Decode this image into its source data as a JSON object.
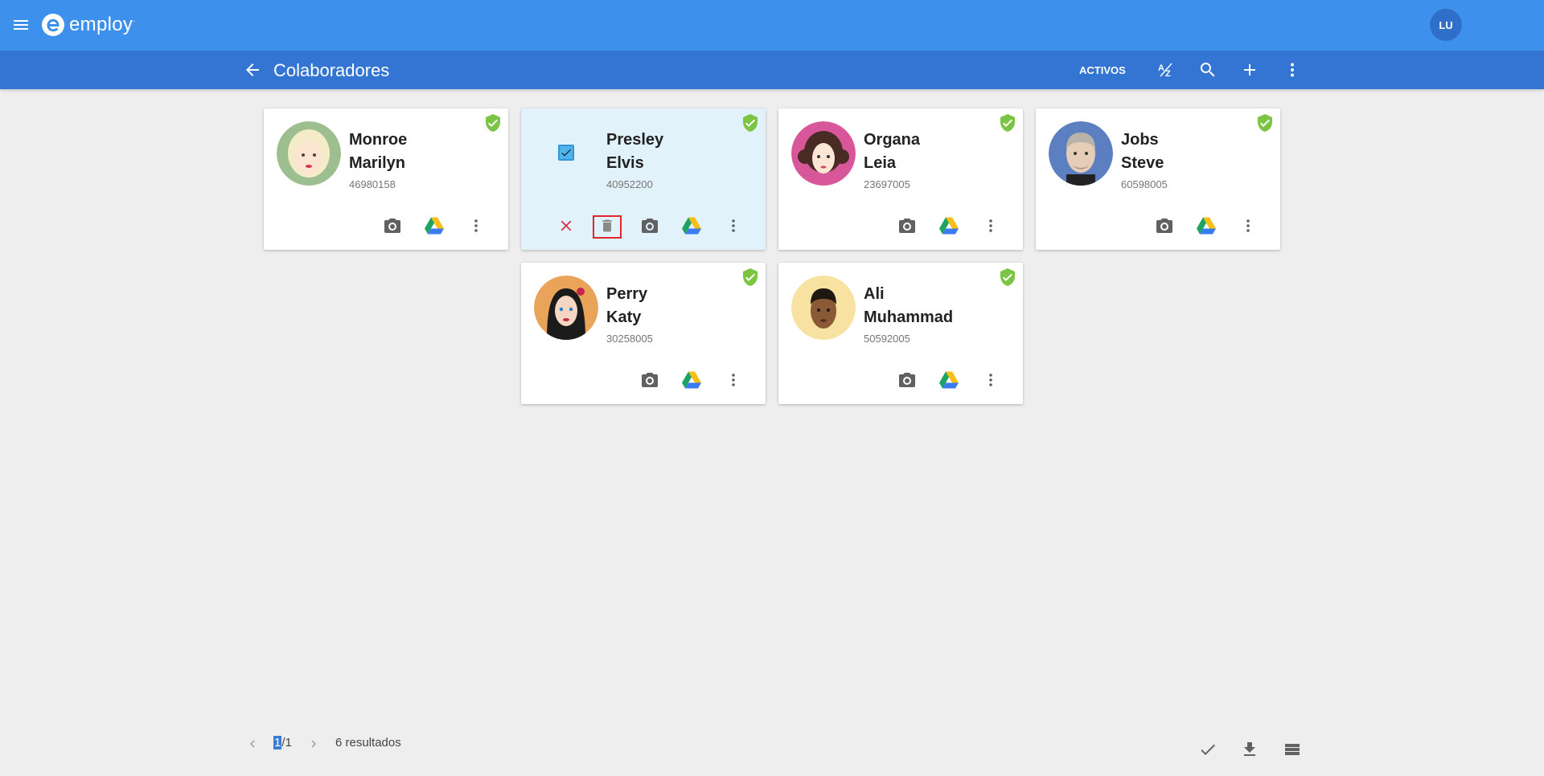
{
  "app": {
    "logo_text": "employ",
    "logo_suffix": "·",
    "user_initials": "LU"
  },
  "toolbar": {
    "title": "Colaboradores",
    "filter_label": "ACTIVOS",
    "sort_icon": "sort-az-icon",
    "search_icon": "search-icon",
    "add_icon": "add-icon",
    "more_icon": "more-vert-icon"
  },
  "employees": [
    {
      "last_name": "Monroe",
      "first_name": "Marilyn",
      "id": "46980158",
      "status": "verified",
      "selected": false
    },
    {
      "last_name": "Presley",
      "first_name": "Elvis",
      "id": "40952200",
      "status": "verified",
      "selected": true
    },
    {
      "last_name": "Organa",
      "first_name": "Leia",
      "id": "23697005",
      "status": "verified",
      "selected": false
    },
    {
      "last_name": "Jobs",
      "first_name": "Steve",
      "id": "60598005",
      "status": "verified",
      "selected": false
    },
    {
      "last_name": "Perry",
      "first_name": "Katy",
      "id": "30258005",
      "status": "verified",
      "selected": false
    },
    {
      "last_name": "Ali",
      "first_name": "Muhammad",
      "id": "50592005",
      "status": "verified",
      "selected": false
    }
  ],
  "card_actions": [
    "camera-icon",
    "google-drive-icon",
    "more-vert-icon"
  ],
  "selected_actions": [
    "close-icon",
    "delete-icon"
  ],
  "pagination": {
    "current": "1",
    "total": "/1",
    "results": "6 resultados"
  },
  "bottom_actions": [
    "check-icon",
    "download-icon",
    "list-view-icon"
  ],
  "colors": {
    "header": "#3d91ec",
    "subheader": "#3475d3",
    "verified": "#7cc444",
    "selected_card": "#e2f2fb",
    "delete_highlight": "#e0252f"
  }
}
